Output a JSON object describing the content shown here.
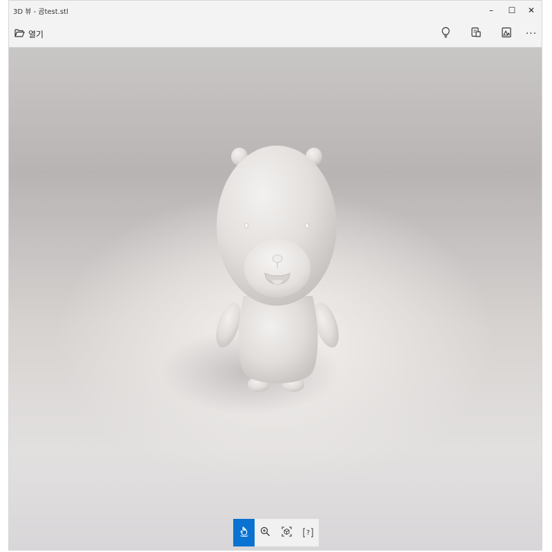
{
  "window": {
    "title": "3D 뷰 - 곰test.stl"
  },
  "title_controls": {
    "minimize": "–",
    "maximize": "☐",
    "close": "✕"
  },
  "toolbar": {
    "open_label": "열기",
    "more_label": "···"
  },
  "icons": {
    "open": "folder-open-icon",
    "lighting": "lightbulb-icon",
    "mixed_reality": "mixed-reality-icon",
    "environment": "environment-icon",
    "more": "more-icon",
    "rotate": "rotate-icon",
    "zoom": "zoom-icon",
    "fit": "fit-view-icon",
    "help": "help-icon"
  },
  "colors": {
    "accent": "#0a72d1",
    "chrome": "#f3f3f3",
    "model": "#e7e5e3"
  },
  "navigation": {
    "active": "rotate",
    "help_glyph": "?"
  }
}
